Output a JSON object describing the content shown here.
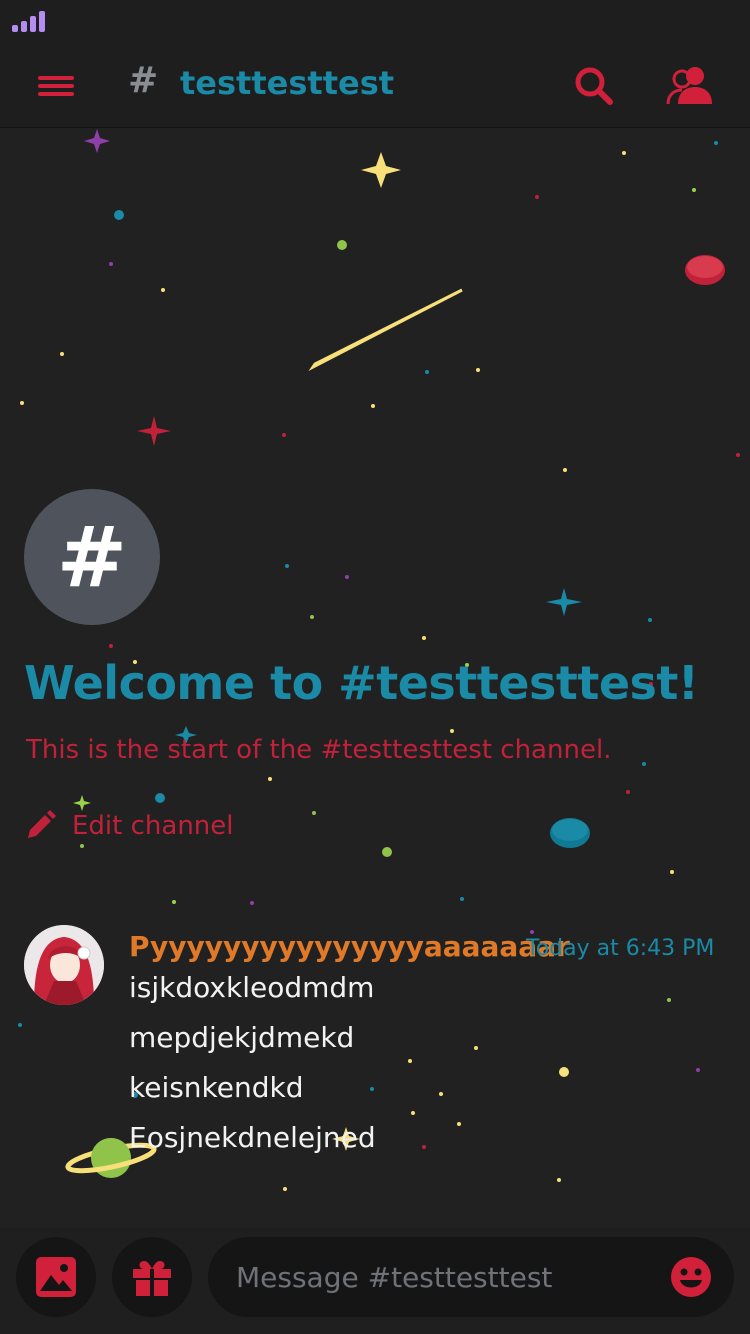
{
  "header": {
    "channel_name": "testtesttest"
  },
  "welcome": {
    "title": "Welcome to #testtesttest!",
    "subtitle": "This is the start of the #testtesttest channel.",
    "edit_label": "Edit channel"
  },
  "message": {
    "author": "Pyyyyyyyyyyyyyyyaaaaaaar",
    "timestamp": "Today at 6:43 PM",
    "lines": [
      "isjkdoxkleodmdm",
      "mepdjekjdmekd",
      "keisnkendkd",
      "Eosjnekdnelejned"
    ]
  },
  "composer": {
    "placeholder": "Message #testtesttest"
  },
  "icons": {
    "menu": "hamburger-menu-icon",
    "search": "search-icon",
    "members": "members-icon",
    "image": "image-icon",
    "gift": "gift-icon",
    "emoji": "emoji-icon",
    "pencil": "pencil-icon",
    "signal": "signal-strength-icon"
  },
  "colors": {
    "background": "#212121",
    "accent_teal": "#1a8aa6",
    "accent_red": "#c2213a",
    "author_orange": "#e07a28",
    "signal_purple": "#b48cf2"
  }
}
